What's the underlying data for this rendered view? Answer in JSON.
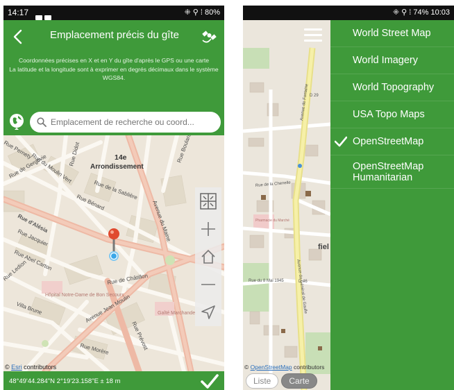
{
  "left_screen": {
    "status": {
      "time": "14:17",
      "right": "⁜ ⚲ ⁞ 80%"
    },
    "header": {
      "title": "Emplacement précis du gîte",
      "desc1": "Coordonnées précises en X et en Y du gîte d'après le GPS ou une carte",
      "desc2": "La latitude et la longitude sont à exprimer en degrés décimaux dans le système WGS84."
    },
    "search": {
      "placeholder": "Emplacement de recherche ou coord..."
    },
    "map_labels": {
      "district1": "14e",
      "district2": "Arrondissement",
      "s1": "Rue de la Sablière",
      "s2": "Rue Bénard",
      "s3": "Rue d'Alésia",
      "s4": "Rue Jacquier",
      "s5": "Rue de Châtillon",
      "s6": "Avenue du Maine",
      "s7": "Avenue Jean Moulin",
      "s8": "Rue Morère",
      "s9": "Villa Brune",
      "s10": "Rue Didot",
      "s11": "Rue Boulard",
      "s12": "Rue de Gergovie",
      "s13": "Rue Abel Carton",
      "s14": "Rue Ledion",
      "s15": "Hôpital Notre-Dame de Bon Secours",
      "s16": "Gaîté Marchande",
      "s17": "Rue Prévost",
      "s18": "Rue du Moulin Vert",
      "s19": "Rue Pernety"
    },
    "attribution": {
      "esri": "Esri",
      "rest": "contributors"
    },
    "footer": {
      "coords": "48°49'44.284\"N 2°19'23.158\"E ± 18 m"
    }
  },
  "right_screen": {
    "status": {
      "right": "⁜ ⚲ ⁞ 74% 10:03"
    },
    "layers": [
      {
        "label": "World Street Map",
        "selected": false
      },
      {
        "label": "World Imagery",
        "selected": false
      },
      {
        "label": "World Topography",
        "selected": false
      },
      {
        "label": "USA Topo Maps",
        "selected": false
      },
      {
        "label": "OpenStreetMap",
        "selected": true
      },
      {
        "label": "OpenStreetMap Humanitarian",
        "selected": false
      }
    ],
    "map_labels": {
      "a": "D 29",
      "b": "Avenue de Fontaine",
      "c": "Rue de la Chenelle",
      "d": "Rue du 8 Mai 1945",
      "e": "Avenue du Général de Gaulle",
      "f": "D 46",
      "g": "fiel",
      "h": "Pharmacie du Marché"
    },
    "attribution": {
      "link": "OpenStreetMap",
      "rest": "contributors"
    },
    "segmented": {
      "list": "Liste",
      "map": "Carte"
    }
  },
  "colors": {
    "header_green": "#3f9a3a",
    "map_bg": "#ede6da",
    "pin_red": "#e04a2f",
    "gps_blue": "#3aa6e8"
  }
}
